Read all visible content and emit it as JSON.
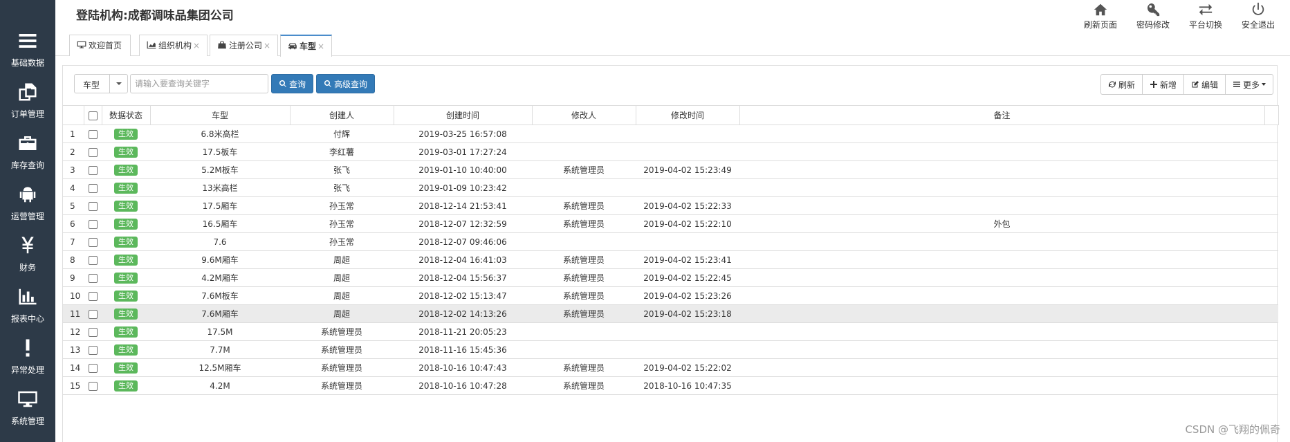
{
  "header": {
    "org_title": "登陆机构:成都调味品集团公司",
    "tools": [
      {
        "label": "刷新页面",
        "icon": "home-icon"
      },
      {
        "label": "密码修改",
        "icon": "key-icon"
      },
      {
        "label": "平台切换",
        "icon": "exchange-icon"
      },
      {
        "label": "安全退出",
        "icon": "power-icon"
      }
    ]
  },
  "sidebar": {
    "items": [
      {
        "label": "基础数据",
        "icon": "menu-icon"
      },
      {
        "label": "订单管理",
        "icon": "copy-icon"
      },
      {
        "label": "库存查询",
        "icon": "briefcase-icon"
      },
      {
        "label": "运营管理",
        "icon": "android-icon"
      },
      {
        "label": "财务",
        "icon": "yen-icon"
      },
      {
        "label": "报表中心",
        "icon": "bar-chart-icon"
      },
      {
        "label": "异常处理",
        "icon": "exclamation-icon"
      },
      {
        "label": "系统管理",
        "icon": "desktop-icon"
      }
    ]
  },
  "tabs": [
    {
      "label": "欢迎首页",
      "close": ""
    },
    {
      "label": "组织机构",
      "close": "×"
    },
    {
      "label": "注册公司",
      "close": "×"
    },
    {
      "label": "车型",
      "close": "×"
    }
  ],
  "search": {
    "field_value": "车型",
    "placeholder": "请输入要查询关键字",
    "query_label": "查询",
    "advanced_label": "高级查询"
  },
  "actions": {
    "refresh": "刷新",
    "add": "新增",
    "edit": "编辑",
    "more": "更多"
  },
  "table": {
    "columns": [
      "数据状态",
      "车型",
      "创建人",
      "创建时间",
      "修改人",
      "修改时间",
      "备注"
    ],
    "rows": [
      {
        "no": "1",
        "status": "生效",
        "model": "6.8米高栏",
        "creator": "付辉",
        "created": "2019-03-25 16:57:08",
        "modifier": "",
        "modified": "",
        "note": ""
      },
      {
        "no": "2",
        "status": "生效",
        "model": "17.5板车",
        "creator": "李红薯",
        "created": "2019-03-01 17:27:24",
        "modifier": "",
        "modified": "",
        "note": ""
      },
      {
        "no": "3",
        "status": "生效",
        "model": "5.2M板车",
        "creator": "张飞",
        "created": "2019-01-10 10:40:00",
        "modifier": "系统管理员",
        "modified": "2019-04-02 15:23:49",
        "note": ""
      },
      {
        "no": "4",
        "status": "生效",
        "model": "13米高栏",
        "creator": "张飞",
        "created": "2019-01-09 10:23:42",
        "modifier": "",
        "modified": "",
        "note": ""
      },
      {
        "no": "5",
        "status": "生效",
        "model": "17.5厢车",
        "creator": "孙玉常",
        "created": "2018-12-14 21:53:41",
        "modifier": "系统管理员",
        "modified": "2019-04-02 15:22:33",
        "note": ""
      },
      {
        "no": "6",
        "status": "生效",
        "model": "16.5厢车",
        "creator": "孙玉常",
        "created": "2018-12-07 12:32:59",
        "modifier": "系统管理员",
        "modified": "2019-04-02 15:22:10",
        "note": "外包"
      },
      {
        "no": "7",
        "status": "生效",
        "model": "7.6",
        "creator": "孙玉常",
        "created": "2018-12-07 09:46:06",
        "modifier": "",
        "modified": "",
        "note": ""
      },
      {
        "no": "8",
        "status": "生效",
        "model": "9.6M厢车",
        "creator": "周超",
        "created": "2018-12-04 16:41:03",
        "modifier": "系统管理员",
        "modified": "2019-04-02 15:23:41",
        "note": ""
      },
      {
        "no": "9",
        "status": "生效",
        "model": "4.2M厢车",
        "creator": "周超",
        "created": "2018-12-04 15:56:37",
        "modifier": "系统管理员",
        "modified": "2019-04-02 15:22:45",
        "note": ""
      },
      {
        "no": "10",
        "status": "生效",
        "model": "7.6M板车",
        "creator": "周超",
        "created": "2018-12-02 15:13:47",
        "modifier": "系统管理员",
        "modified": "2019-04-02 15:23:26",
        "note": ""
      },
      {
        "no": "11",
        "status": "生效",
        "model": "7.6M厢车",
        "creator": "周超",
        "created": "2018-12-02 14:13:26",
        "modifier": "系统管理员",
        "modified": "2019-04-02 15:23:18",
        "note": ""
      },
      {
        "no": "12",
        "status": "生效",
        "model": "17.5M",
        "creator": "系统管理员",
        "created": "2018-11-21 20:05:23",
        "modifier": "",
        "modified": "",
        "note": ""
      },
      {
        "no": "13",
        "status": "生效",
        "model": "7.7M",
        "creator": "系统管理员",
        "created": "2018-11-16 15:45:36",
        "modifier": "",
        "modified": "",
        "note": ""
      },
      {
        "no": "14",
        "status": "生效",
        "model": "12.5M厢车",
        "creator": "系统管理员",
        "created": "2018-10-16 10:47:43",
        "modifier": "系统管理员",
        "modified": "2019-04-02 15:22:02",
        "note": ""
      },
      {
        "no": "15",
        "status": "生效",
        "model": "4.2M",
        "creator": "系统管理员",
        "created": "2018-10-16 10:47:28",
        "modifier": "系统管理员",
        "modified": "2018-10-16 10:47:35",
        "note": ""
      }
    ]
  },
  "watermark": "CSDN @飞翔的佩奇"
}
